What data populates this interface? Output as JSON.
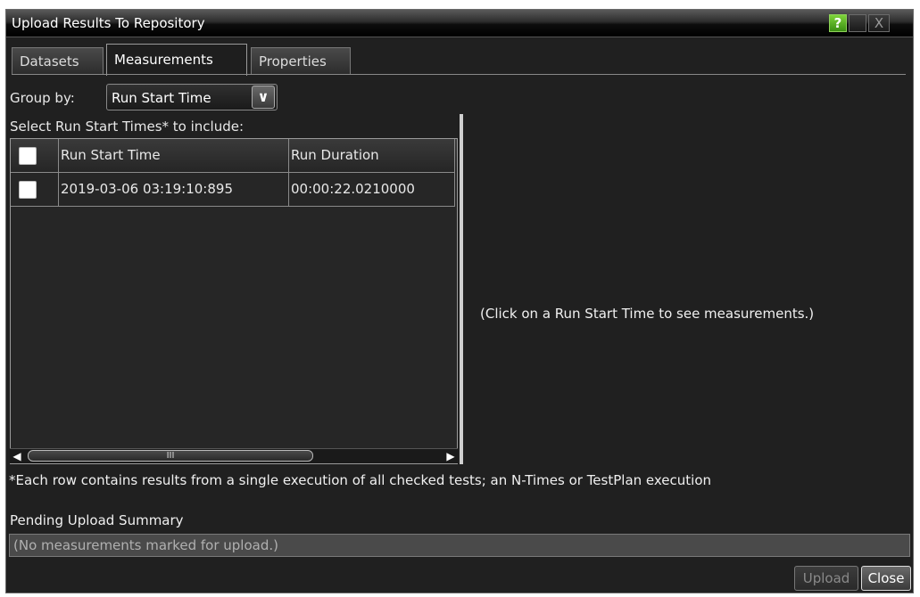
{
  "window": {
    "title": "Upload Results To Repository",
    "help_symbol": "?",
    "close_symbol": "X"
  },
  "tabs": [
    {
      "label": "Datasets"
    },
    {
      "label": "Measurements"
    },
    {
      "label": "Properties"
    }
  ],
  "group_by": {
    "label": "Group by:",
    "value": "Run Start Time"
  },
  "select_label": "Select Run Start Times* to include:",
  "grid": {
    "columns": [
      "Run Start Time",
      "Run Duration"
    ],
    "rows": [
      {
        "checked": false,
        "start": "2019-03-06 03:19:10:895",
        "duration": "00:00:22.0210000"
      }
    ]
  },
  "scrollbar": {
    "thumb_grip": "III"
  },
  "right_panel_message": "(Click on a Run Start Time to see measurements.)",
  "footnote": "*Each row contains results from a single execution of all checked tests; an N-Times or TestPlan execution",
  "pending": {
    "label": "Pending Upload Summary",
    "value": "(No measurements marked for upload.)"
  },
  "buttons": {
    "upload": "Upload",
    "close": "Close"
  },
  "colors": {
    "background": "#202020",
    "help_green": "#5bb82a",
    "text": "#e8e8e8"
  }
}
